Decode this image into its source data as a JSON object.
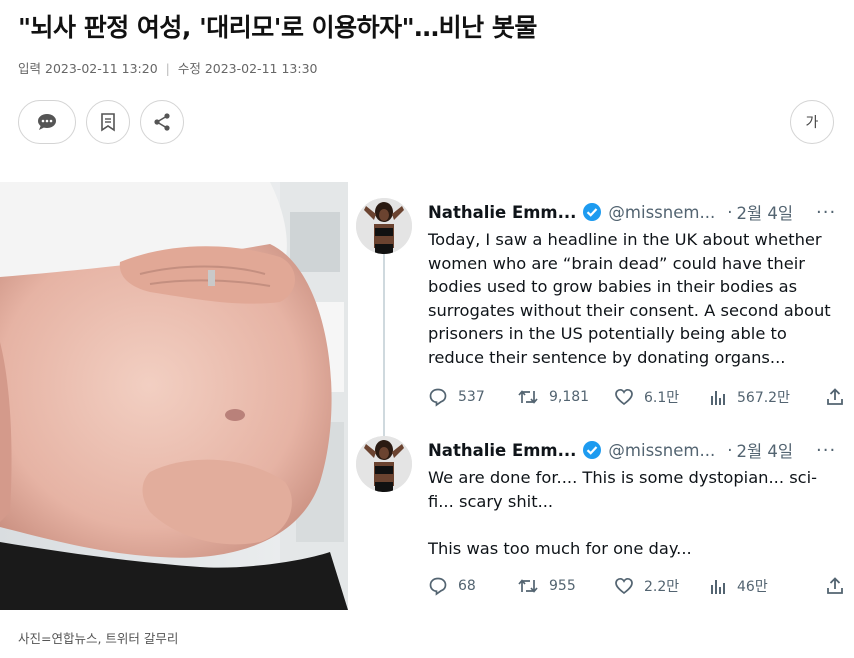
{
  "article": {
    "headline": "\"뇌사 판정 여성, '대리모'로 이용하자\"…비난 봇물",
    "meta": {
      "input_label": "입력",
      "input_time": "2023-02-11 13:20",
      "modified_label": "수정",
      "modified_time": "2023-02-11 13:30"
    },
    "buttons": {
      "comment_icon": "speech-bubble-icon",
      "bookmark_icon": "bookmark-icon",
      "share_icon": "share-icon",
      "font_size_label": "가"
    },
    "caption": "사진=연합뉴스, 트위터 갈무리"
  },
  "tweets": [
    {
      "name": "Nathalie Emm...",
      "handle": "@missnem...",
      "date": "2월 4일",
      "more": "···",
      "text": "Today, I saw a headline in the UK about whether women who are “brain dead” could have their bodies used to grow babies in their bodies as surrogates without their consent. A second about prisoners in the US potentially being able to reduce their sentence by donating organs...",
      "replies": "537",
      "retweets": "9,181",
      "likes": "6.1만",
      "views": "567.2만"
    },
    {
      "name": "Nathalie Emm...",
      "handle": "@missnem...",
      "date": "2월 4일",
      "more": "···",
      "text": "We are done for.... This is some dystopian... sci-fi... scary shit...\n\nThis was too much for one day...",
      "replies": "68",
      "retweets": "955",
      "likes": "2.2만",
      "views": "46만"
    }
  ],
  "colors": {
    "verified": "#1d9bf0",
    "secondary_text": "#536471",
    "border": "#d4d4d4"
  }
}
